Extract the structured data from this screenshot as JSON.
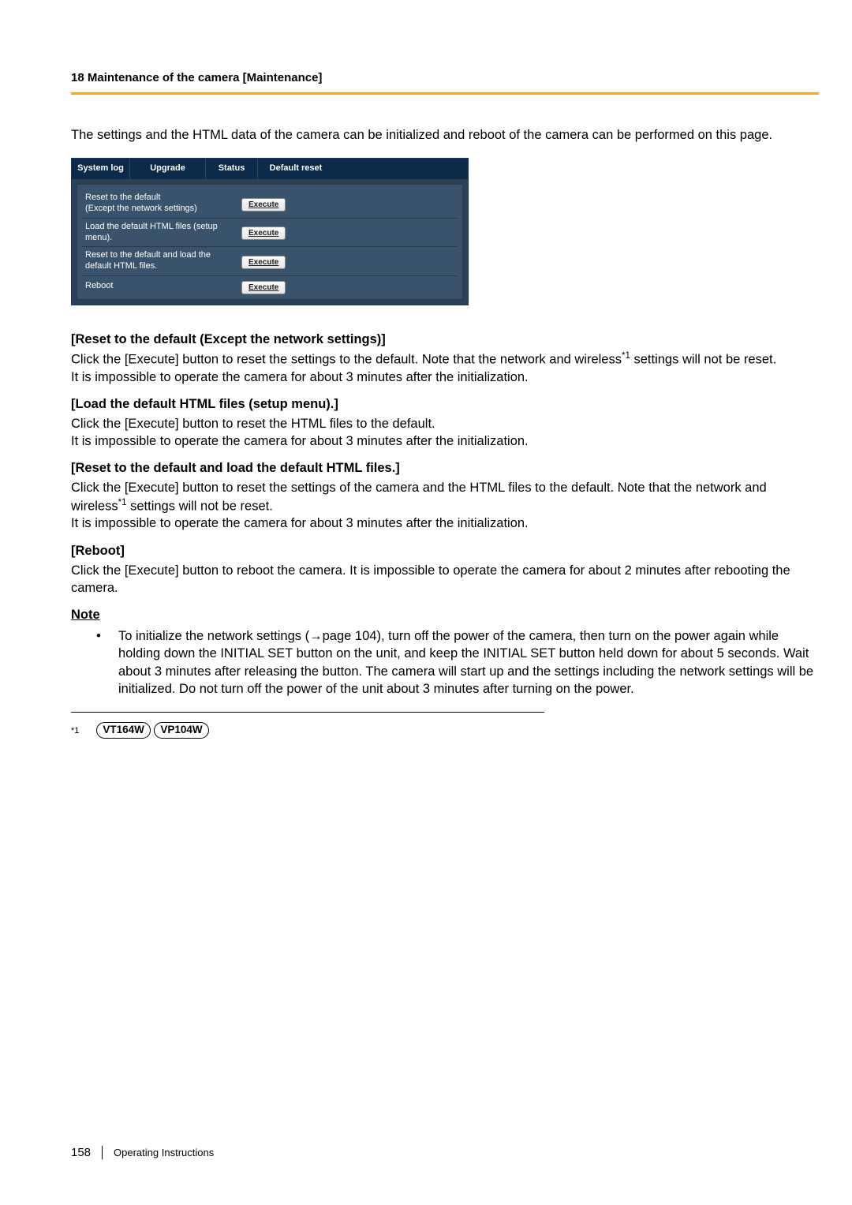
{
  "header": {
    "chapter": "18 Maintenance of the camera [Maintenance]"
  },
  "intro": "The settings and the HTML data of the camera can be initialized and reboot of the camera can be performed on this page.",
  "ui": {
    "tabs": {
      "system_log": "System log",
      "upgrade": "Upgrade",
      "status": "Status",
      "default_reset": "Default reset"
    },
    "rows": [
      {
        "label": "Reset to the default\n(Except the network settings)",
        "button": "Execute"
      },
      {
        "label": "Load the default HTML files (setup menu).",
        "button": "Execute"
      },
      {
        "label": "Reset to the default and load the default HTML files.",
        "button": "Execute"
      },
      {
        "label": "Reboot",
        "button": "Execute"
      }
    ]
  },
  "sections": {
    "reset_default": {
      "heading": "[Reset to the default (Except the network settings)]",
      "text_a": "Click the [Execute] button to reset the settings to the default. Note that the network and wireless",
      "text_b": " settings will not be reset.",
      "text_c": "It is impossible to operate the camera for about 3 minutes after the initialization."
    },
    "load_html": {
      "heading": "[Load the default HTML files (setup menu).]",
      "text_a": "Click the [Execute] button to reset the HTML files to the default.",
      "text_b": "It is impossible to operate the camera for about 3 minutes after the initialization."
    },
    "reset_and_load": {
      "heading": "[Reset to the default and load the default HTML files.]",
      "text_a": "Click the [Execute] button to reset the settings of the camera and the HTML files to the default. Note that the network and wireless",
      "text_b": " settings will not be reset.",
      "text_c": "It is impossible to operate the camera for about 3 minutes after the initialization."
    },
    "reboot": {
      "heading": "[Reboot]",
      "text": "Click the [Execute] button to reboot the camera. It is impossible to operate the camera for about 2 minutes after rebooting the camera."
    }
  },
  "note": {
    "heading": "Note",
    "bullet": "•",
    "item_a": "To initialize the network settings (",
    "item_arrow": "→",
    "item_b": "page 104), turn off the power of the camera, then turn on the power again while holding down the INITIAL SET button on the unit, and keep the INITIAL SET button held down for about 5 seconds. Wait about 3 minutes after releasing the button. The camera will start up and the settings including the network settings will be initialized. Do not turn off the power of the unit about 3 minutes after turning on the power."
  },
  "footnote": {
    "marker": "*1",
    "models": [
      "VT164W",
      "VP104W"
    ]
  },
  "footer": {
    "page": "158",
    "title": "Operating Instructions"
  },
  "sup": "*1"
}
